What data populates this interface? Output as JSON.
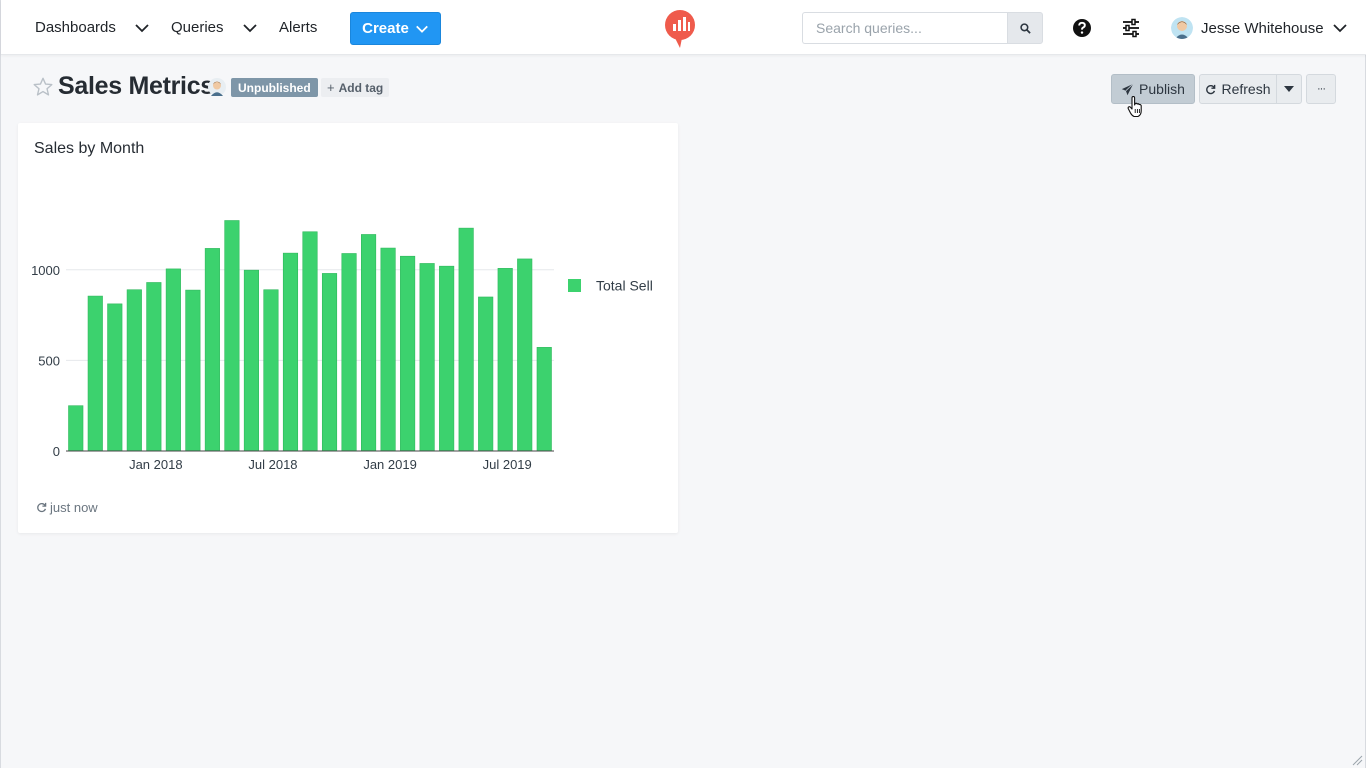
{
  "nav": {
    "dashboards": "Dashboards",
    "queries": "Queries",
    "alerts": "Alerts",
    "create": "Create",
    "search_placeholder": "Search queries...",
    "user_name": "Jesse Whitehouse"
  },
  "colors": {
    "brand": "#ef5b4c",
    "primary": "#2196f3",
    "bar": "#3cd26e",
    "badge": "#7e96a8"
  },
  "page": {
    "title": "Sales Metrics",
    "status_badge": "Unpublished",
    "add_tag": "Add tag",
    "publish": "Publish",
    "refresh": "Refresh",
    "more": "···"
  },
  "widget": {
    "title": "Sales by Month",
    "updated": "just now"
  },
  "chart_data": {
    "type": "bar",
    "title": "Sales by Month",
    "xlabel": "",
    "ylabel": "",
    "ylim": [
      0,
      1400
    ],
    "yticks": [
      0,
      500,
      1000
    ],
    "xtick_labels": [
      {
        "month": "2018-01",
        "label": "Jan 2018"
      },
      {
        "month": "2018-07",
        "label": "Jul 2018"
      },
      {
        "month": "2019-01",
        "label": "Jan 2019"
      },
      {
        "month": "2019-07",
        "label": "Jul 2019"
      }
    ],
    "grid": true,
    "legend_position": "right",
    "categories": [
      "2017-09",
      "2017-10",
      "2017-11",
      "2017-12",
      "2018-01",
      "2018-02",
      "2018-03",
      "2018-04",
      "2018-05",
      "2018-06",
      "2018-07",
      "2018-08",
      "2018-09",
      "2018-10",
      "2018-11",
      "2018-12",
      "2019-01",
      "2019-02",
      "2019-03",
      "2019-04",
      "2019-05",
      "2019-06",
      "2019-07",
      "2019-08",
      "2019-09"
    ],
    "series": [
      {
        "name": "Total Sell",
        "values": [
          250,
          855,
          812,
          890,
          930,
          1005,
          888,
          1118,
          1272,
          998,
          890,
          1092,
          1210,
          980,
          1090,
          1195,
          1120,
          1075,
          1035,
          1020,
          1230,
          850,
          1008,
          1060,
          572
        ]
      }
    ]
  }
}
